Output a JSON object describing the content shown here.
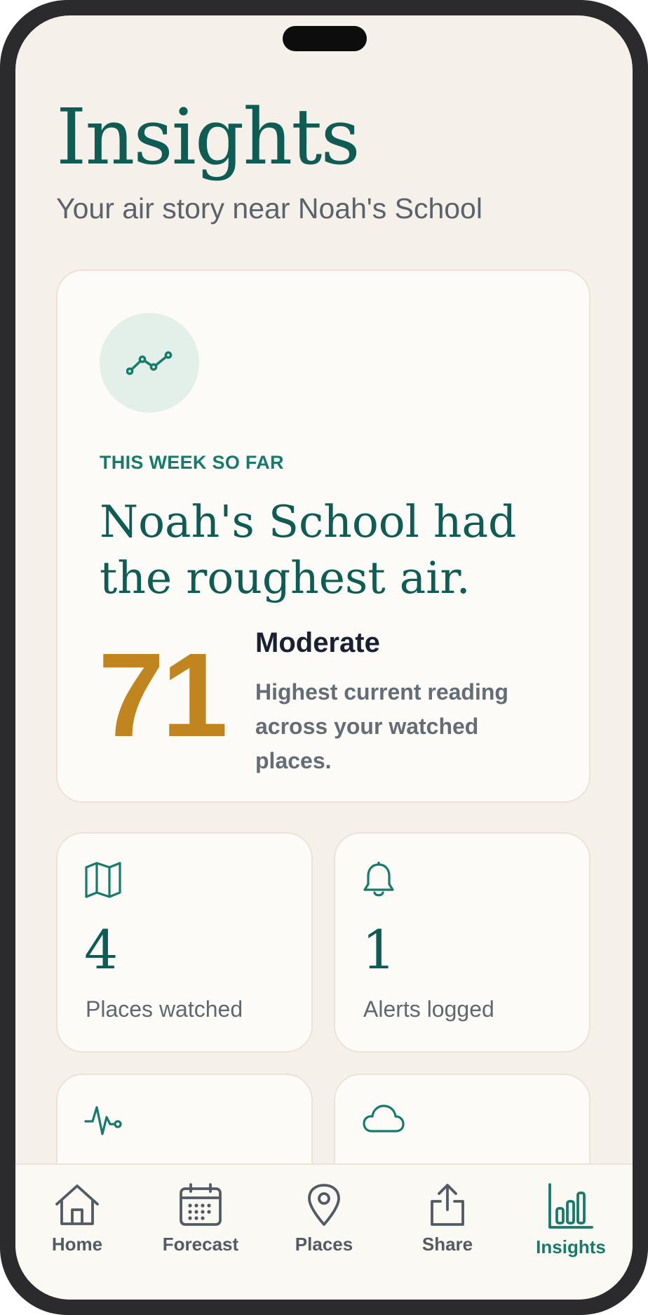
{
  "header": {
    "title": "Insights",
    "subtitle": "Your air story near Noah's School"
  },
  "hero": {
    "icon": "trend-line-icon",
    "eyebrow": "THIS WEEK SO FAR",
    "headline": "Noah's School had the roughest air.",
    "value": "71",
    "level": "Moderate",
    "description": "Highest current reading across your watched places."
  },
  "stats": [
    {
      "icon": "map-icon",
      "value": "4",
      "label": "Places watched"
    },
    {
      "icon": "bell-icon",
      "value": "1",
      "label": "Alerts logged"
    },
    {
      "icon": "pulse-icon"
    },
    {
      "icon": "cloud-icon"
    }
  ],
  "tabs": [
    {
      "icon": "home-icon",
      "label": "Home"
    },
    {
      "icon": "calendar-icon",
      "label": "Forecast"
    },
    {
      "icon": "location-pin-icon",
      "label": "Places"
    },
    {
      "icon": "share-icon",
      "label": "Share"
    },
    {
      "icon": "bar-chart-icon",
      "label": "Insights",
      "active": true
    }
  ],
  "colors": {
    "brand": "#0f5c54",
    "accent": "#177a6b",
    "moderate": "#c0851f",
    "background": "#f5f1ea",
    "card": "#fcfbf7"
  }
}
